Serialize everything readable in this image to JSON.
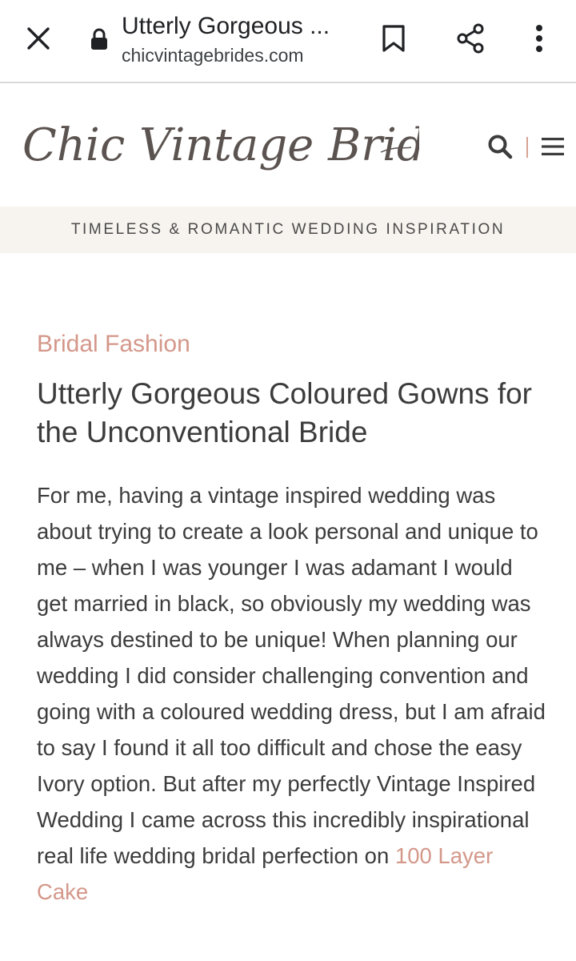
{
  "browser": {
    "tab_title": "Utterly Gorgeous ...",
    "domain": "chicvintagebrides.com",
    "icons": [
      "close-icon",
      "lock-icon",
      "bookmark-icon",
      "share-icon",
      "more-vert-icon"
    ]
  },
  "site": {
    "logo_text": "Chic Vintage Brides",
    "tagline": "TIMELESS & ROMANTIC WEDDING INSPIRATION",
    "icons": [
      "search-icon",
      "menu-icon"
    ]
  },
  "article": {
    "category": "Bridal Fashion",
    "title": "Utterly Gorgeous Coloured Gowns for the Unconventional Bride",
    "body": "For me, having a vintage inspired wedding was about trying to create a look personal and unique to me – when I was younger I was adamant I would get married in black, so obviously my wedding was always destined to be unique! When planning our wedding I did consider challenging convention and going with a coloured wedding dress, but I am afraid to say I found it all too difficult and chose the easy Ivory option. But after my perfectly Vintage Inspired Wedding I came across this incredibly inspirational real life wedding bridal perfection on ",
    "link_text": "100 Layer Cake"
  },
  "colors": {
    "accent": "#d4978a",
    "text": "#3c3c3c",
    "tagline_bg": "#f7f3ef",
    "logo": "#5b5350"
  }
}
